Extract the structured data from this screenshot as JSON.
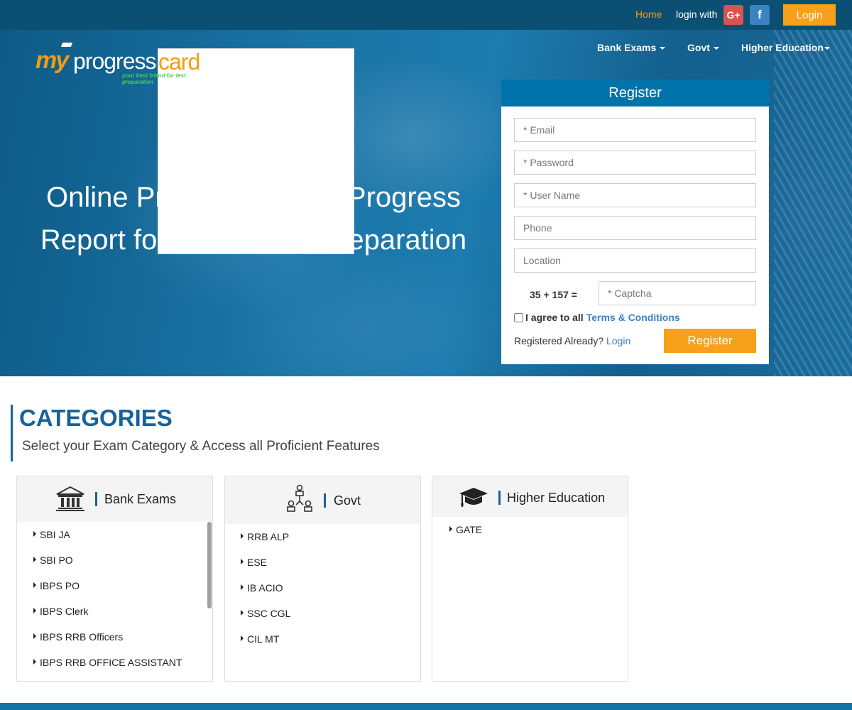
{
  "topbar": {
    "home_label": "Home",
    "login_with_label": "login with",
    "google_icon": "G+",
    "facebook_icon": "f",
    "login_button": "Login"
  },
  "logo": {
    "my": "my",
    "progress": "progress",
    "card": "card",
    "tagline": "your best friend for test preparation"
  },
  "nav": {
    "items": [
      {
        "label": "Bank Exams"
      },
      {
        "label": "Govt"
      },
      {
        "label": "Higher Education"
      }
    ]
  },
  "hero": {
    "headline_line1": "Online Practice Tests & Progress",
    "headline_line2": "Report for Your Exam Preparation"
  },
  "register": {
    "title": "Register",
    "email_placeholder": "* Email",
    "password_placeholder": "* Password",
    "username_placeholder": "* User Name",
    "phone_placeholder": "Phone",
    "location_placeholder": "Location",
    "captcha_question": "35 + 157 =",
    "captcha_placeholder": "* Captcha",
    "agree_text": "I agree to all",
    "terms_link": "Terms & Conditions",
    "registered_already": "Registered Already?",
    "login_link": "Login",
    "submit_label": "Register"
  },
  "categories": {
    "title": "CATEGORIES",
    "subtitle": "Select your Exam Category & Access all Proficient Features",
    "cards": [
      {
        "title": "Bank Exams",
        "icon": "bank-icon",
        "items": [
          "SBI JA",
          "SBI PO",
          "IBPS PO",
          "IBPS Clerk",
          "IBPS RRB Officers",
          "IBPS RRB OFFICE ASSISTANT"
        ]
      },
      {
        "title": "Govt",
        "icon": "org-chart-icon",
        "items": [
          "RRB ALP",
          "ESE",
          "IB ACIO",
          "SSC CGL",
          "CIL MT"
        ]
      },
      {
        "title": "Higher Education",
        "icon": "graduation-cap-icon",
        "items": [
          "GATE"
        ]
      }
    ]
  },
  "colors": {
    "topbar": "#0b4f72",
    "accent_orange": "#f7a01a",
    "brand_blue": "#17639a",
    "register_header": "#0073ab",
    "link_blue": "#3b82c4"
  }
}
